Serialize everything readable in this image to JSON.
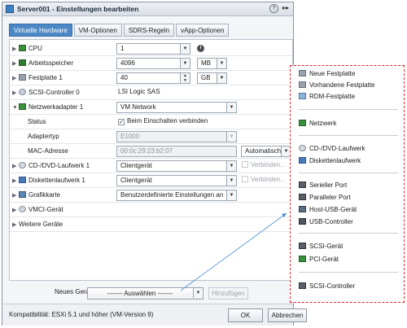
{
  "title": "Server001 - Einstellungen bearbeiten",
  "title_buttons": {
    "help": "?",
    "more": "▸▸"
  },
  "tabs": [
    "Virtuelle Hardware",
    "VM-Optionen",
    "SDRS-Regeln",
    "vApp-Optionen"
  ],
  "active_tab": "Virtuelle Hardware",
  "hardware": {
    "cpu": {
      "label": "CPU",
      "value": "1",
      "info": "i"
    },
    "memory": {
      "label": "Arbeitsspeicher",
      "value": "4096",
      "unit": "MB"
    },
    "disk": {
      "label": "Festplatte 1",
      "value": "40",
      "unit": "GB"
    },
    "scsi": {
      "label": "SCSI-Controller 0",
      "value": "LSI Logic SAS"
    },
    "nic": {
      "label": "Netzwerkadapter 1",
      "value": "VM Network",
      "status_label": "Status",
      "status_value": "Beim Einschalten verbinden",
      "status_check": "✓",
      "adapter_label": "Adaptertyp",
      "adapter_value": "E1000",
      "mac_label": "MAC-Adresse",
      "mac_value": "00:0c:29:23:b2:07",
      "mac_mode": "Automatisch"
    },
    "cdrom": {
      "label": "CD-/DVD-Laufwerk 1",
      "value": "Clientgerät",
      "connect": "Verbinden..."
    },
    "floppy": {
      "label": "Diskettenlaufwerk 1",
      "value": "Clientgerät",
      "connect": "Verbinden..."
    },
    "video": {
      "label": "Grafikkarte",
      "value": "Benutzerdefinierte Einstellungen an"
    },
    "vmci": {
      "label": "VMCI-Gerät"
    },
    "other": {
      "label": "Weitere Geräte"
    }
  },
  "new_device": {
    "label": "Neues Gerät:",
    "select": "------- Auswählen -------",
    "add": "Hinzufügen"
  },
  "footer": {
    "compat": "Kompatibilität: ESXi 5.1 und höher (VM-Version 9)",
    "ok": "OK",
    "cancel": "Abbrechen"
  },
  "menu": {
    "groups": [
      [
        "Neue Festplatte",
        "Vorhandene Festplatte",
        "RDM-Festplatte"
      ],
      [
        "Netzwerk"
      ],
      [
        "CD-/DVD-Laufwerk",
        "Diskettenlaufwerk"
      ],
      [
        "Serieller Port",
        "Paralleler Port",
        "Host-USB-Gerät",
        "USB-Controller"
      ],
      [
        "SCSI-Gerät",
        "PCI-Gerät"
      ],
      [
        "SCSI-Controller"
      ]
    ]
  },
  "colors": {
    "accent": "#4d88c6",
    "highlight_border": "#e0242b"
  }
}
